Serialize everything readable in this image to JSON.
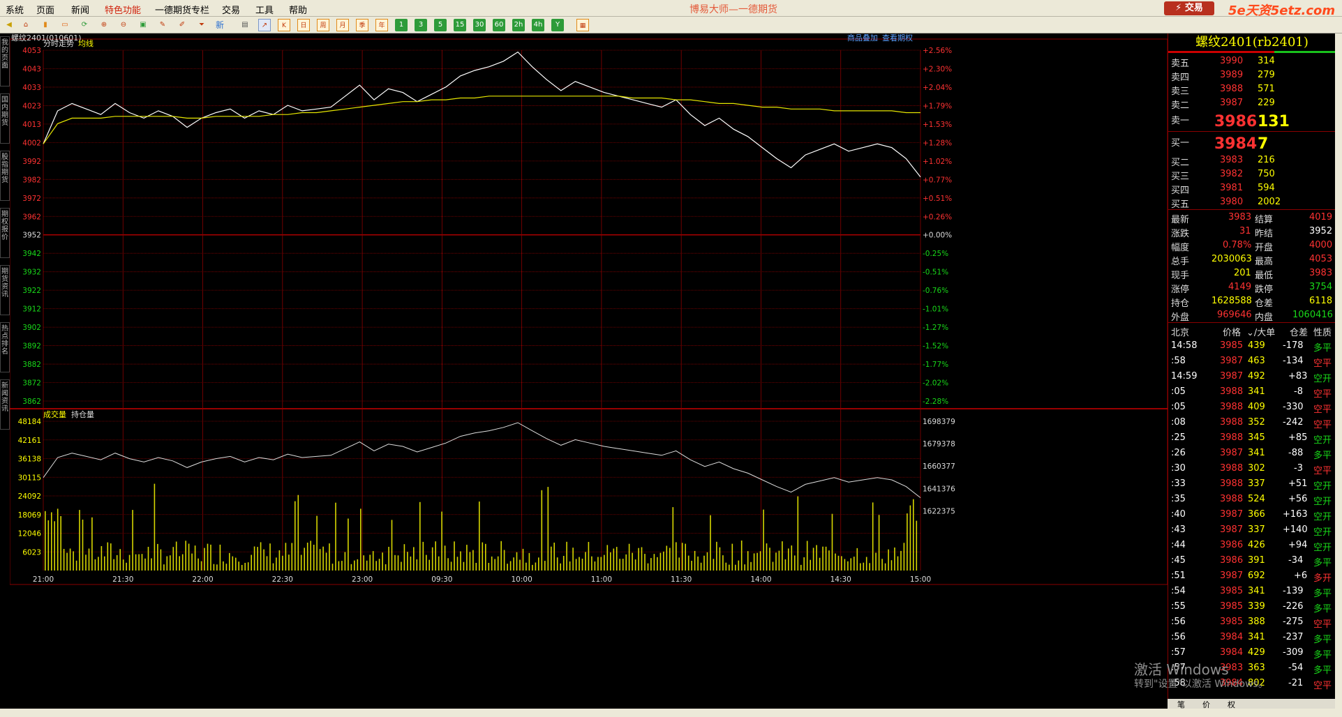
{
  "menubar": {
    "items": [
      "系统",
      "页面",
      "新闻",
      "特色功能",
      "一德期货专栏",
      "交易",
      "工具",
      "帮助"
    ],
    "app_title": "博易大师—一德期货",
    "trade_button": "⚡ 交易",
    "watermark": "5e天资5etz.com"
  },
  "toolbar": {
    "numbers": [
      "1",
      "3",
      "5",
      "15",
      "30",
      "60",
      "2h",
      "4h",
      "Y"
    ],
    "calendar": [
      "日",
      "周",
      "月",
      "季",
      "年"
    ],
    "new_label": "新"
  },
  "sidebar": {
    "tabs": [
      "我的页面",
      "国内期货",
      "股指期货",
      "期权报价",
      "期货资讯",
      "热点排名",
      "新闻资讯"
    ]
  },
  "chart": {
    "symbol_label": "螺纹2401(010601)",
    "overlay_link": "商品叠加",
    "option_link": "查看期权",
    "legend_price": "分时走势",
    "legend_avg": "均线",
    "legend_vol": "成交量",
    "legend_oi": "持仓量",
    "price_ticks": [
      "4053",
      "4043",
      "4033",
      "4023",
      "4013",
      "4002",
      "3992",
      "3982",
      "3972",
      "3962",
      "3952",
      "3942",
      "3932",
      "3922",
      "3912",
      "3902",
      "3892",
      "3882",
      "3872",
      "3862"
    ],
    "pct_ticks": [
      "+2.56%",
      "+2.30%",
      "+2.04%",
      "+1.79%",
      "+1.53%",
      "+1.28%",
      "+1.02%",
      "+0.77%",
      "+0.51%",
      "+0.26%",
      "+0.00%",
      "-0.25%",
      "-0.51%",
      "-0.76%",
      "-1.01%",
      "-1.27%",
      "-1.52%",
      "-1.77%",
      "-2.02%",
      "-2.28%"
    ],
    "vol_ticks": [
      "48184",
      "42161",
      "36138",
      "30115",
      "24092",
      "18069",
      "12046",
      "6023"
    ],
    "oi_ticks": [
      "1698379",
      "1679378",
      "1660377",
      "1641376",
      "1622375"
    ],
    "time_ticks": [
      "21:00",
      "21:30",
      "22:00",
      "22:30",
      "23:00",
      "09:30",
      "10:00",
      "11:00",
      "11:30",
      "14:00",
      "14:30",
      "15:00"
    ],
    "colors": {
      "price_line": "#ffffff",
      "avg_line": "#e6e600",
      "grid": "#8a0000",
      "volume_bar": "#d6d600",
      "up": "#ff3232",
      "down": "#19d919"
    }
  },
  "chart_data": {
    "type": "line",
    "x_label_times": [
      "21:00",
      "21:30",
      "22:00",
      "22:30",
      "23:00",
      "09:30",
      "10:00",
      "11:00",
      "11:30",
      "14:00",
      "14:30",
      "15:00"
    ],
    "price_range": [
      3857,
      4058
    ],
    "prev_settle": 3952,
    "series": [
      {
        "name": "分时走势",
        "values": [
          4002,
          4020,
          4024,
          4021,
          4018,
          4024,
          4019,
          4016,
          4020,
          4017,
          4011,
          4016,
          4019,
          4021,
          4016,
          4020,
          4018,
          4023,
          4020,
          4021,
          4022,
          4028,
          4034,
          4026,
          4032,
          4030,
          4025,
          4029,
          4033,
          4039,
          4042,
          4044,
          4047,
          4052,
          4044,
          4037,
          4031,
          4036,
          4033,
          4030,
          4028,
          4026,
          4024,
          4022,
          4026,
          4018,
          4012,
          4016,
          4010,
          4006,
          4000,
          3994,
          3989,
          3996,
          3999,
          4002,
          3998,
          4000,
          4002,
          4000,
          3994,
          3984
        ]
      },
      {
        "name": "均线",
        "values": [
          4002,
          4013,
          4016,
          4016,
          4016,
          4017,
          4017,
          4017,
          4017,
          4017,
          4016,
          4016,
          4017,
          4017,
          4017,
          4017,
          4018,
          4018,
          4019,
          4019,
          4020,
          4021,
          4022,
          4023,
          4024,
          4025,
          4025,
          4026,
          4026,
          4027,
          4027,
          4028,
          4028,
          4028,
          4028,
          4028,
          4028,
          4028,
          4028,
          4028,
          4028,
          4027,
          4027,
          4027,
          4026,
          4026,
          4025,
          4024,
          4024,
          4023,
          4022,
          4022,
          4021,
          4021,
          4021,
          4020,
          4020,
          4020,
          4020,
          4020,
          4019,
          4019
        ]
      }
    ]
  },
  "order_book": {
    "title": "螺纹2401(rb2401)",
    "asks": [
      {
        "label": "卖五",
        "price": "3990",
        "vol": "314"
      },
      {
        "label": "卖四",
        "price": "3989",
        "vol": "279"
      },
      {
        "label": "卖三",
        "price": "3988",
        "vol": "571"
      },
      {
        "label": "卖二",
        "price": "3987",
        "vol": "229"
      },
      {
        "label": "卖一",
        "price": "3986",
        "vol": "131"
      }
    ],
    "bids": [
      {
        "label": "买一",
        "price": "3984",
        "vol": "7"
      },
      {
        "label": "买二",
        "price": "3983",
        "vol": "216"
      },
      {
        "label": "买三",
        "price": "3982",
        "vol": "750"
      },
      {
        "label": "买四",
        "price": "3981",
        "vol": "594"
      },
      {
        "label": "买五",
        "price": "3980",
        "vol": "2002"
      }
    ]
  },
  "quote_stats": [
    {
      "l1": "最新",
      "v1": "3983",
      "c1": "red",
      "l2": "结算",
      "v2": "4019",
      "c2": "red"
    },
    {
      "l1": "涨跌",
      "v1": "31",
      "c1": "red",
      "l2": "昨结",
      "v2": "3952",
      "c2": "wht"
    },
    {
      "l1": "幅度",
      "v1": "0.78%",
      "c1": "red",
      "l2": "开盘",
      "v2": "4000",
      "c2": "red"
    },
    {
      "l1": "总手",
      "v1": "2030063",
      "c1": "yel",
      "l2": "最高",
      "v2": "4053",
      "c2": "red"
    },
    {
      "l1": "现手",
      "v1": "201",
      "c1": "yel",
      "l2": "最低",
      "v2": "3983",
      "c2": "red"
    },
    {
      "l1": "涨停",
      "v1": "4149",
      "c1": "red",
      "l2": "跌停",
      "v2": "3754",
      "c2": "grn"
    },
    {
      "l1": "持仓",
      "v1": "1628588",
      "c1": "yel",
      "l2": "仓差",
      "v2": "6118",
      "c2": "yel"
    },
    {
      "l1": "外盘",
      "v1": "969646",
      "c1": "red",
      "l2": "内盘",
      "v2": "1060416",
      "c2": "grn"
    }
  ],
  "ticks_header": {
    "time": "北京",
    "price": "价格",
    "vol": "⌄/大单",
    "oi": "仓差",
    "type": "性质"
  },
  "ticks": [
    {
      "t": "14:58",
      "p": "3985",
      "v": "439",
      "o": "-178",
      "k": "多平",
      "kc": "grn"
    },
    {
      "t": ":58",
      "p": "3987",
      "v": "463",
      "o": "-134",
      "k": "空平",
      "kc": "red"
    },
    {
      "t": "14:59",
      "p": "3987",
      "v": "492",
      "o": "+83",
      "k": "空开",
      "kc": "grn"
    },
    {
      "t": ":05",
      "p": "3988",
      "v": "341",
      "o": "-8",
      "k": "空平",
      "kc": "red"
    },
    {
      "t": ":05",
      "p": "3988",
      "v": "409",
      "o": "-330",
      "k": "空平",
      "kc": "red"
    },
    {
      "t": ":08",
      "p": "3988",
      "v": "352",
      "o": "-242",
      "k": "空平",
      "kc": "red"
    },
    {
      "t": ":25",
      "p": "3988",
      "v": "345",
      "o": "+85",
      "k": "空开",
      "kc": "grn"
    },
    {
      "t": ":26",
      "p": "3987",
      "v": "341",
      "o": "-88",
      "k": "多平",
      "kc": "grn"
    },
    {
      "t": ":30",
      "p": "3988",
      "v": "302",
      "o": "-3",
      "k": "空平",
      "kc": "red"
    },
    {
      "t": ":33",
      "p": "3988",
      "v": "337",
      "o": "+51",
      "k": "空开",
      "kc": "grn"
    },
    {
      "t": ":35",
      "p": "3988",
      "v": "524",
      "o": "+56",
      "k": "空开",
      "kc": "grn"
    },
    {
      "t": ":40",
      "p": "3987",
      "v": "366",
      "o": "+163",
      "k": "空开",
      "kc": "grn"
    },
    {
      "t": ":43",
      "p": "3987",
      "v": "337",
      "o": "+140",
      "k": "空开",
      "kc": "grn"
    },
    {
      "t": ":44",
      "p": "3986",
      "v": "426",
      "o": "+94",
      "k": "空开",
      "kc": "grn"
    },
    {
      "t": ":45",
      "p": "3986",
      "v": "391",
      "o": "-34",
      "k": "多平",
      "kc": "grn"
    },
    {
      "t": ":51",
      "p": "3987",
      "v": "692",
      "o": "+6",
      "k": "多开",
      "kc": "red"
    },
    {
      "t": ":54",
      "p": "3985",
      "v": "341",
      "o": "-139",
      "k": "多平",
      "kc": "grn"
    },
    {
      "t": ":55",
      "p": "3985",
      "v": "339",
      "o": "-226",
      "k": "多平",
      "kc": "grn"
    },
    {
      "t": ":56",
      "p": "3985",
      "v": "388",
      "o": "-275",
      "k": "空平",
      "kc": "red"
    },
    {
      "t": ":56",
      "p": "3984",
      "v": "341",
      "o": "-237",
      "k": "多平",
      "kc": "grn"
    },
    {
      "t": ":57",
      "p": "3984",
      "v": "429",
      "o": "-309",
      "k": "多平",
      "kc": "grn"
    },
    {
      "t": ":57",
      "p": "3983",
      "v": "363",
      "o": "-54",
      "k": "多平",
      "kc": "grn"
    },
    {
      "t": ":58",
      "p": "3984",
      "v": "802",
      "o": "-21",
      "k": "空平",
      "kc": "red"
    }
  ],
  "tabs_bottom": [
    "笔",
    "价",
    "权"
  ],
  "os_watermark": {
    "line1": "激活 Windows",
    "line2": "转到\"设置\"以激活 Windows。"
  }
}
